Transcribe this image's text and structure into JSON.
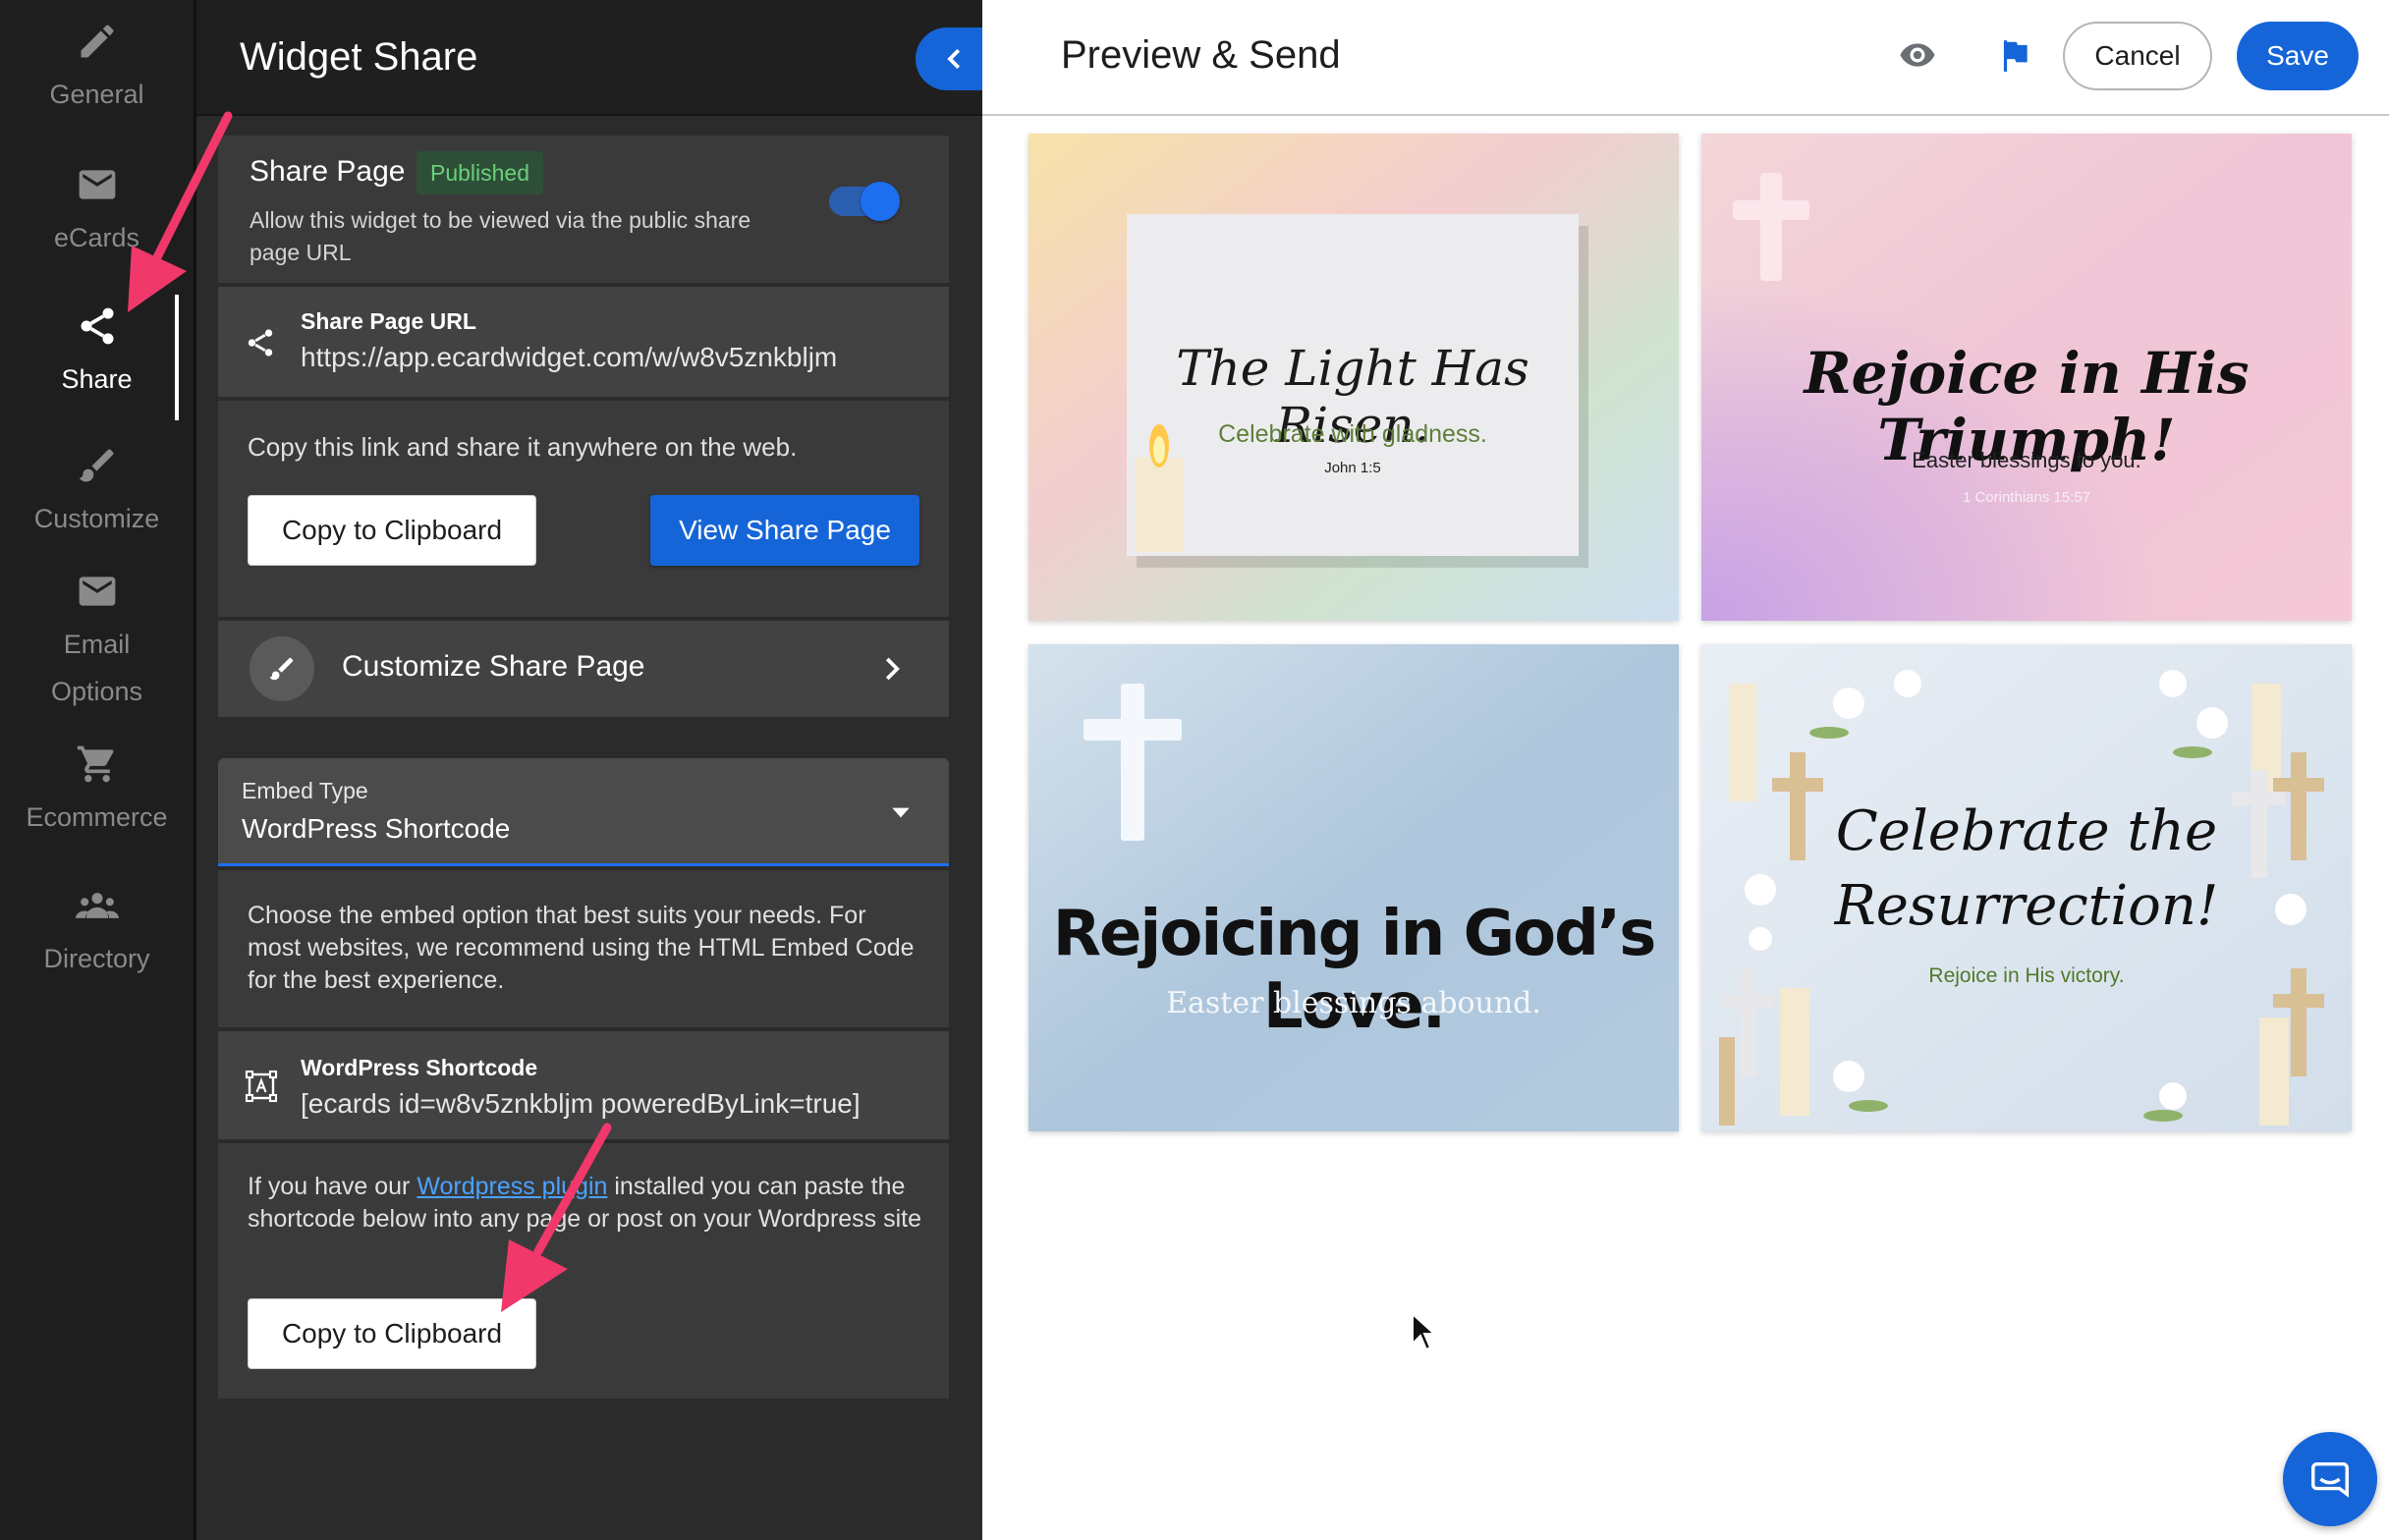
{
  "rail": {
    "items": [
      {
        "label": "General",
        "icon": "pencil-icon"
      },
      {
        "label": "eCards",
        "icon": "envelope-icon"
      },
      {
        "label": "Share",
        "icon": "share-icon",
        "active": true
      },
      {
        "label": "Customize",
        "icon": "brush-icon"
      },
      {
        "label_line1": "Email",
        "label_line2": "Options",
        "icon": "envelope-icon"
      },
      {
        "label": "Ecommerce",
        "icon": "cart-icon"
      },
      {
        "label": "Directory",
        "icon": "people-icon"
      }
    ]
  },
  "panel": {
    "title": "Widget Share",
    "share_page": {
      "label": "Share Page",
      "badge": "Published",
      "description": "Allow this widget to be viewed via the public share page URL",
      "toggle_on": true
    },
    "share_url": {
      "label": "Share Page URL",
      "value": "https://app.ecardwidget.com/w/w8v5znkbljm"
    },
    "copy_info": "Copy this link and share it anywhere on the web.",
    "copy_button": "Copy to Clipboard",
    "view_button": "View Share Page",
    "customize_share": "Customize Share Page",
    "embed": {
      "label": "Embed Type",
      "value": "WordPress Shortcode",
      "description": "Choose the embed option that best suits your needs. For most websites, we recommend using the HTML Embed Code for the best experience."
    },
    "shortcode": {
      "label": "WordPress Shortcode",
      "value": "[ecards id=w8v5znkbljm poweredByLink=true]"
    },
    "plugin_info": {
      "prefix": "If you have our ",
      "link": "Wordpress plugin",
      "suffix": " installed you can paste the shortcode below into any page or post on your Wordpress site"
    },
    "copy_button_2": "Copy to Clipboard"
  },
  "main": {
    "title": "Preview & Send",
    "cancel": "Cancel",
    "save": "Save",
    "cards": [
      {
        "title": "The Light Has Risen.",
        "subtitle": "Celebrate with gladness.",
        "verse": "John 1:5"
      },
      {
        "title": "Rejoice in His Triumph!",
        "subtitle": "Easter blessings to you.",
        "verse": "1 Corinthians 15:57"
      },
      {
        "title": "Rejoicing in God’s Love.",
        "subtitle": "Easter blessings abound."
      },
      {
        "title_line1": "Celebrate the",
        "title_line2": "Resurrection!",
        "subtitle": "Rejoice in His victory."
      }
    ]
  },
  "colors": {
    "accent": "#1565d8",
    "published_bg": "#2e4f37",
    "published_text": "#6ad07c",
    "arrow": "#f0386b"
  }
}
